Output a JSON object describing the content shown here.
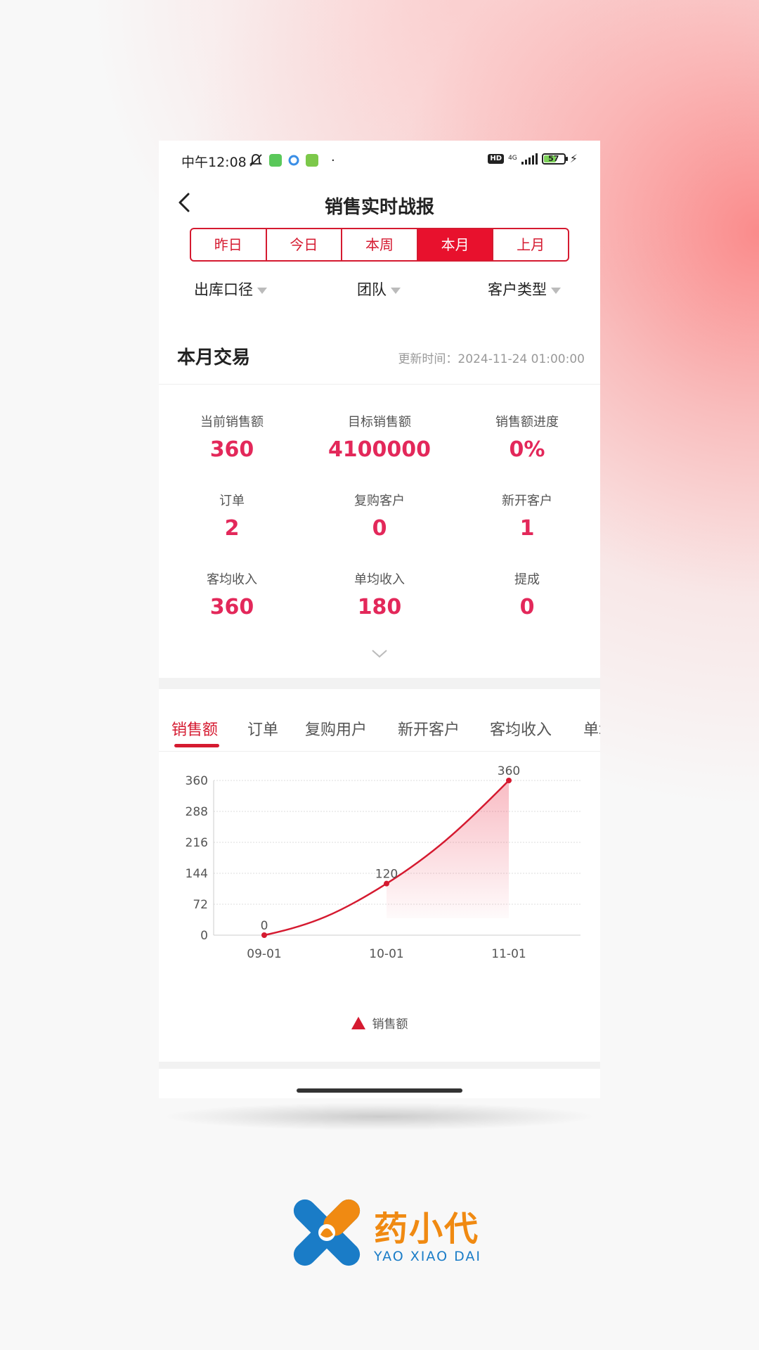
{
  "status_bar": {
    "time": "中午12:08",
    "hd": "HD",
    "network": "4G",
    "battery": "57",
    "dot": "·",
    "bolt": "⚡"
  },
  "header": {
    "title": "销售实时战报",
    "periods": [
      {
        "label": "昨日",
        "active": false
      },
      {
        "label": "今日",
        "active": false
      },
      {
        "label": "本周",
        "active": false
      },
      {
        "label": "本月",
        "active": true
      },
      {
        "label": "上月",
        "active": false
      }
    ],
    "filters": [
      {
        "label": "出库口径"
      },
      {
        "label": "团队"
      },
      {
        "label": "客户类型"
      }
    ]
  },
  "summary": {
    "title": "本月交易",
    "updated": "更新时间：2024-11-24 01:00:00",
    "metrics": [
      {
        "label": "当前销售额",
        "value": "360"
      },
      {
        "label": "目标销售额",
        "value": "4100000"
      },
      {
        "label": "销售额进度",
        "value": "0%"
      },
      {
        "label": "订单",
        "value": "2"
      },
      {
        "label": "复购客户",
        "value": "0"
      },
      {
        "label": "新开客户",
        "value": "1"
      },
      {
        "label": "客均收入",
        "value": "360"
      },
      {
        "label": "单均收入",
        "value": "180"
      },
      {
        "label": "提成",
        "value": "0"
      }
    ]
  },
  "chart_tabs": [
    {
      "label": "销售额",
      "active": true
    },
    {
      "label": "订单",
      "active": false
    },
    {
      "label": "复购用户",
      "active": false
    },
    {
      "label": "新开客户",
      "active": false
    },
    {
      "label": "客均收入",
      "active": false
    },
    {
      "label": "单均收入",
      "active": false
    }
  ],
  "chart_data": {
    "type": "area",
    "categories": [
      "09-01",
      "10-01",
      "11-01"
    ],
    "series": [
      {
        "name": "销售额",
        "values": [
          0,
          120,
          360
        ]
      }
    ],
    "yticks": [
      0,
      72,
      144,
      216,
      288,
      360
    ],
    "ylim": [
      0,
      360
    ],
    "grid": true,
    "legend_position": "bottom",
    "line_color": "#d51a30"
  },
  "brand": {
    "name_cn": "药小代",
    "name_en": "YAO XIAO DAI",
    "colors": {
      "orange": "#f08a12",
      "blue": "#1a7cc7"
    }
  },
  "colors": {
    "accent": "#e8112d",
    "value": "#e3285a"
  }
}
